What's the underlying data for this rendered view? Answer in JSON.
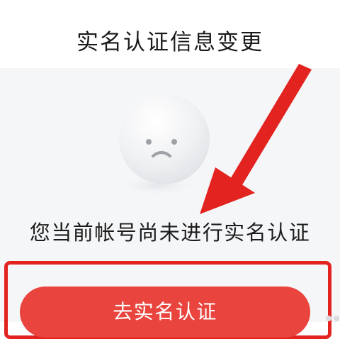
{
  "header": {
    "title": "实名认证信息变更"
  },
  "empty_state": {
    "illustration_icon": "sad-face-icon",
    "message": "您当前帐号尚未进行实名认证"
  },
  "actions": {
    "verify_button_label": "去实名认证"
  },
  "colors": {
    "accent": "#e9443e",
    "annotation": "#e22320",
    "background": "#f5f6f8"
  }
}
